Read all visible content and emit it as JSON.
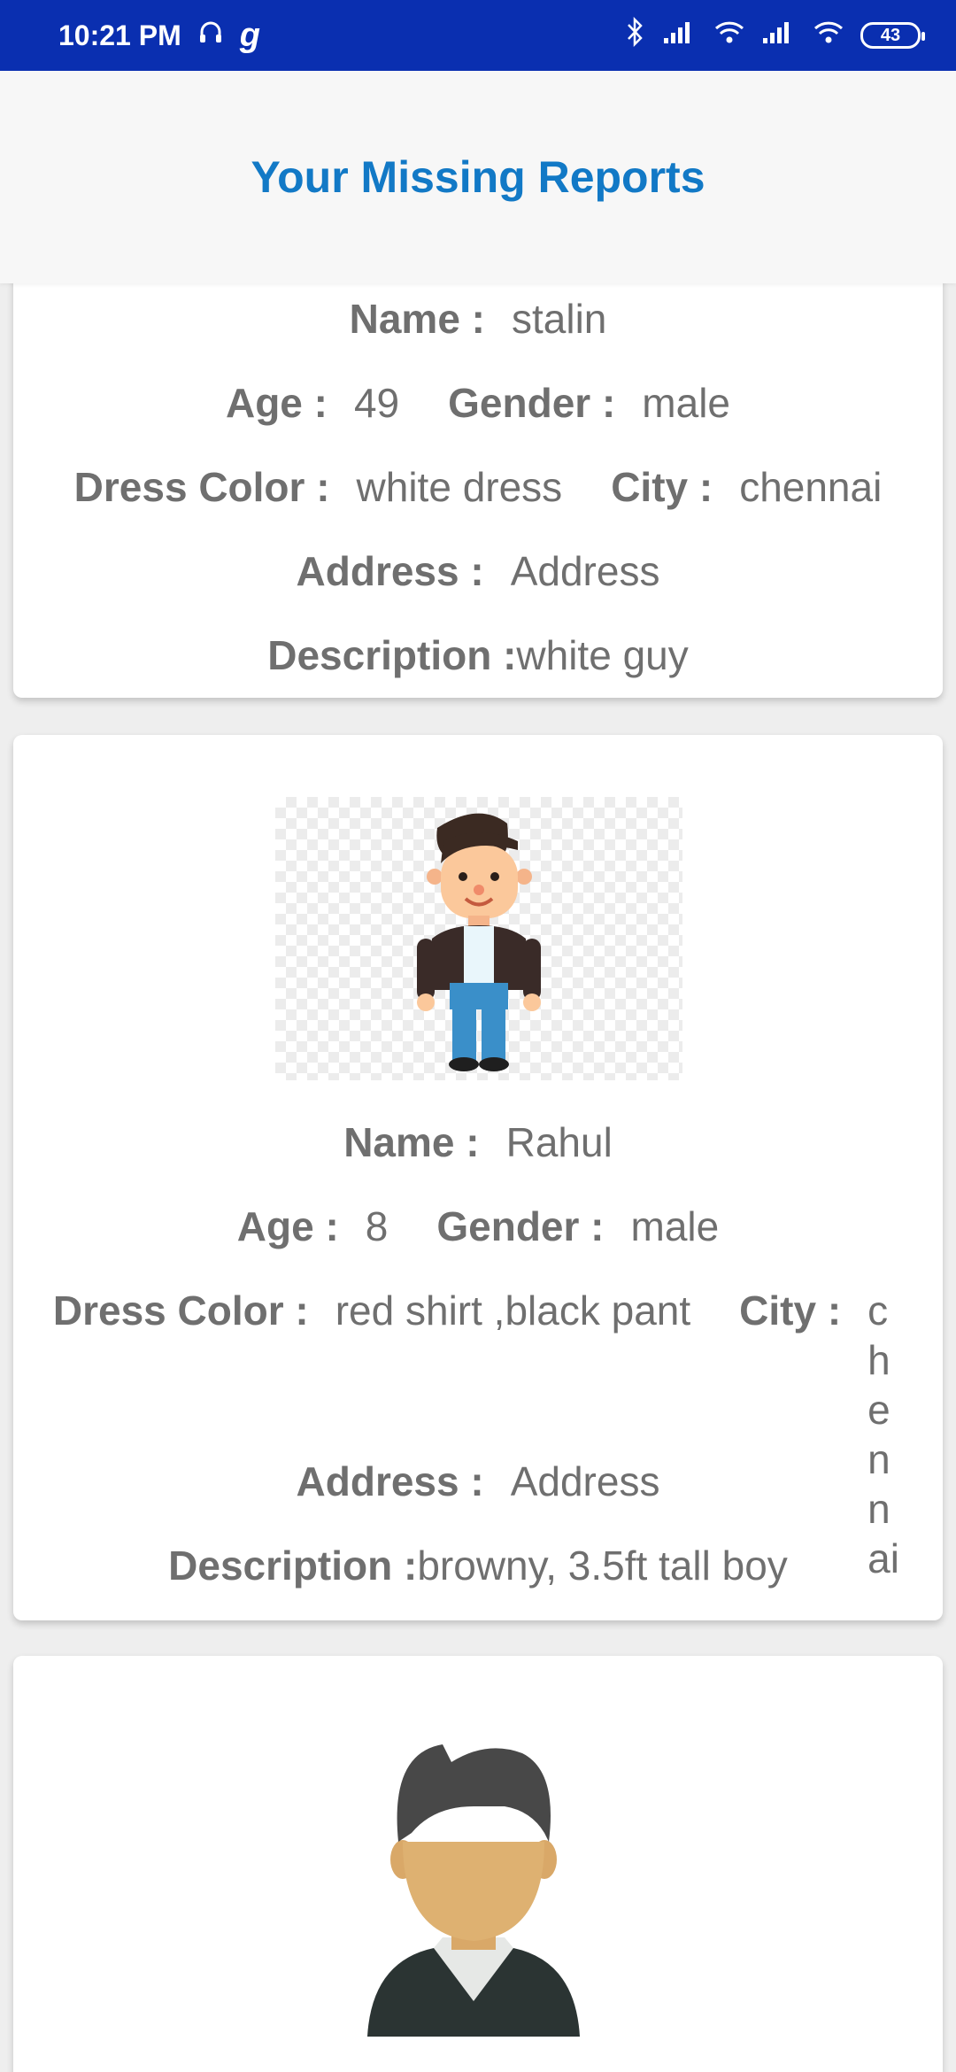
{
  "status_bar": {
    "time": "10:21 PM",
    "app_glyph": "g",
    "battery": "43",
    "icons": [
      "headphones-icon",
      "bluetooth-icon",
      "signal-icon",
      "wifi-icon",
      "battery-icon"
    ]
  },
  "header": {
    "title": "Your Missing Reports"
  },
  "labels": {
    "name": "Name :",
    "age": "Age :",
    "gender": "Gender :",
    "dress": "Dress Color :",
    "city": "City :",
    "address": "Address :",
    "description": "Description :"
  },
  "reports": [
    {
      "name": "stalin",
      "age": "49",
      "gender": "male",
      "dress": "white dress",
      "city": "chennai",
      "address": "Address",
      "description": "white guy"
    },
    {
      "name": "Rahul",
      "age": "8",
      "gender": "male",
      "dress": "red shirt ,black pant",
      "city": "chennai",
      "address": "Address",
      "description": "browny, 3.5ft tall boy"
    }
  ],
  "colors": {
    "status_bar": "#0a2fb0",
    "title": "#1279c6",
    "text": "#6f6f6f"
  }
}
